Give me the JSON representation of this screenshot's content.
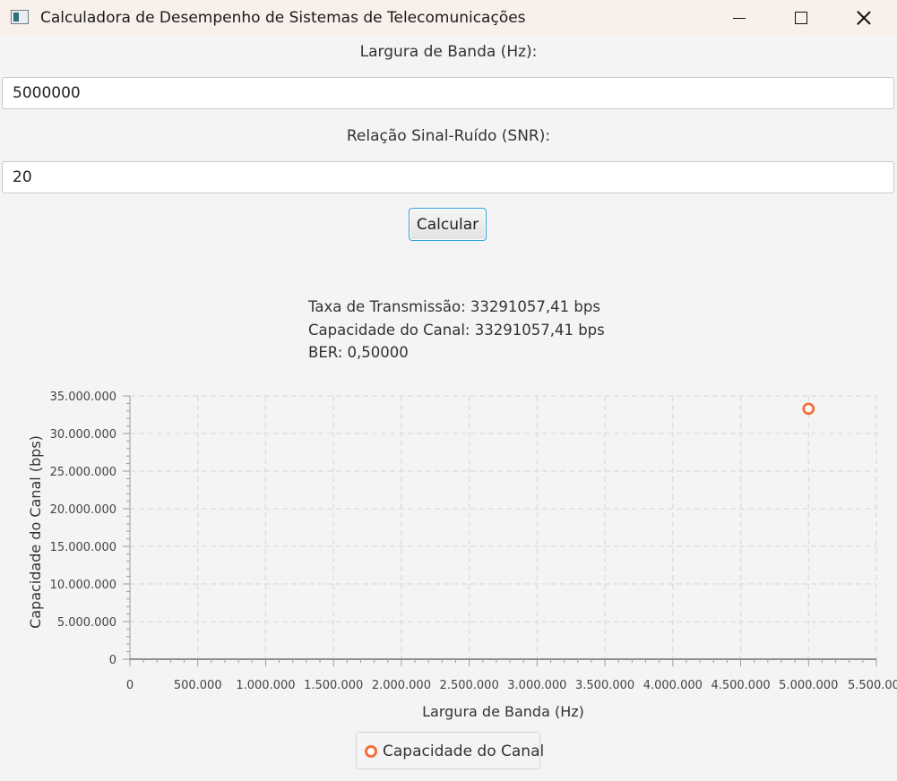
{
  "window": {
    "title": "Calculadora de Desempenho de Sistemas de Telecomunicações",
    "icon": "app-window-icon"
  },
  "form": {
    "bandwidth_label": "Largura de Banda (Hz):",
    "bandwidth_value": "5000000",
    "snr_label": "Relação Sinal-Ruído (SNR):",
    "snr_value": "20",
    "calculate_label": "Calcular"
  },
  "results": {
    "transmission_rate": "Taxa de Transmissão: 33291057,41 bps",
    "channel_capacity": "Capacidade do Canal: 33291057,41 bps",
    "ber": "BER: 0,50000"
  },
  "chart_data": {
    "type": "scatter",
    "title": "",
    "xlabel": "Largura de Banda (Hz)",
    "ylabel": "Capacidade do Canal (bps)",
    "xlim": [
      0,
      5500000
    ],
    "ylim": [
      0,
      35000000
    ],
    "x_ticks": [
      0,
      500000,
      1000000,
      1500000,
      2000000,
      2500000,
      3000000,
      3500000,
      4000000,
      4500000,
      5000000,
      5500000
    ],
    "x_tick_labels": [
      "0",
      "500.000",
      "1.000.000",
      "1.500.000",
      "2.000.000",
      "2.500.000",
      "3.000.000",
      "3.500.000",
      "4.000.000",
      "4.500.000",
      "5.000.000",
      "5.500.000"
    ],
    "y_ticks": [
      0,
      5000000,
      10000000,
      15000000,
      20000000,
      25000000,
      30000000,
      35000000
    ],
    "y_tick_labels": [
      "0",
      "5.000.000",
      "10.000.000",
      "15.000.000",
      "20.000.000",
      "25.000.000",
      "30.000.000",
      "35.000.000"
    ],
    "grid": true,
    "legend_placement": "bottom-center",
    "series": [
      {
        "name": "Capacidade do Canal",
        "color": "#f06f3a",
        "points": [
          {
            "x": 5000000,
            "y": 33291057.41
          }
        ]
      }
    ]
  }
}
